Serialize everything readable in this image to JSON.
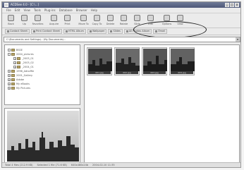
{
  "window": {
    "title": "ACDSee 4.0 - [C:\\...]"
  },
  "menubar": [
    "File",
    "Edit",
    "View",
    "Tools",
    "Plug-ins",
    "Database",
    "Browser",
    "Help"
  ],
  "toolbar": [
    {
      "label": "Back",
      "icon": "back-icon"
    },
    {
      "label": "Up",
      "icon": "up-folder-icon"
    },
    {
      "label": "Favorites",
      "icon": "favorites-icon"
    },
    {
      "label": "Acquire",
      "icon": "acquire-icon"
    },
    {
      "label": "Print",
      "icon": "print-icon"
    },
    {
      "label": "Move To",
      "icon": "move-icon"
    },
    {
      "label": "Copy To",
      "icon": "copy-icon"
    },
    {
      "label": "Delete",
      "icon": "delete-icon"
    },
    {
      "label": "Rotate",
      "icon": "rotate-icon"
    },
    {
      "label": "Slide",
      "icon": "slideshow-icon"
    },
    {
      "label": "Edit",
      "icon": "edit-icon"
    },
    {
      "label": "Options",
      "icon": "options-icon"
    },
    {
      "label": "View",
      "icon": "view-icon"
    }
  ],
  "actionbar": [
    "Contact Sheet",
    "Print Contact Sheet",
    "HTML Album",
    "Wallpaper",
    "Slides",
    "All Photos Album",
    "Email"
  ],
  "address": "C:\\Documents and Settings\\...\\My Documents\\...",
  "tree": [
    {
      "label": "BSSE",
      "indent": 1,
      "kind": "folder"
    },
    {
      "label": "2004_pictures",
      "indent": 1,
      "kind": "folder"
    },
    {
      "label": "_2003_01",
      "indent": 2,
      "kind": "folder"
    },
    {
      "label": "_2003_02",
      "indent": 2,
      "kind": "folder"
    },
    {
      "label": "_2004_01",
      "indent": 2,
      "kind": "folder"
    },
    {
      "label": "1996_Adnoffie",
      "indent": 1,
      "kind": "folder"
    },
    {
      "label": "2001_Gallery",
      "indent": 1,
      "kind": "folder"
    },
    {
      "label": "Adobe",
      "indent": 1,
      "kind": "folder"
    },
    {
      "label": "My eBooks",
      "indent": 1,
      "kind": "folder"
    },
    {
      "label": "My Pictures",
      "indent": 1,
      "kind": "folder"
    }
  ],
  "thumbnails": [
    {
      "caption": "001.jpg"
    },
    {
      "caption": "002.jpg"
    },
    {
      "caption": "003.jpg"
    },
    {
      "caption": "004.jpg"
    }
  ],
  "status": {
    "total": "Total 4 files (212.9 KB)",
    "selected": "Selected 1 file (71.6 KB)",
    "dimensions": "640x480x24b",
    "modified": "2004-02-10 11:35"
  },
  "colors": {
    "titlebar": "#5c6686",
    "thumb_bg": "#555555",
    "highlight": "#222222"
  }
}
